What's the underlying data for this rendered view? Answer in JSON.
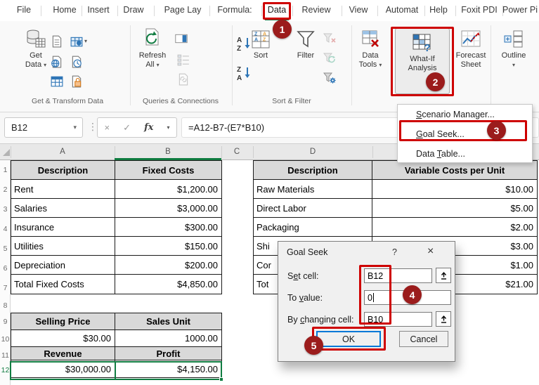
{
  "tabs": [
    "File",
    "Home",
    "Insert",
    "Draw",
    "Page Lay",
    "Formula:",
    "Data",
    "Review",
    "View",
    "Automat",
    "Help",
    "Foxit PDI",
    "Power Pi"
  ],
  "ribbon": {
    "get_data": {
      "line1": "Get",
      "line2": "Data"
    },
    "refresh_all": {
      "line1": "Refresh",
      "line2": "All"
    },
    "sort": "Sort",
    "filter": "Filter",
    "data_tools": {
      "line1": "Data",
      "line2": "Tools"
    },
    "what_if": {
      "line1": "What-If",
      "line2": "Analysis"
    },
    "forecast": {
      "line1": "Forecast",
      "line2": "Sheet"
    },
    "outline": "Outline",
    "group_labels": {
      "g1": "Get & Transform Data",
      "g2": "Queries & Connections",
      "g3": "Sort & Filter"
    }
  },
  "formula_bar": {
    "name_box": "B12",
    "formula": "=A12-B7-(E7*B10)"
  },
  "glyphs": {
    "chevron_down": "▾",
    "dots": "⋮",
    "cancel_x": "×",
    "check": "✓",
    "fx": "fx"
  },
  "menu": {
    "items": [
      {
        "pre": "",
        "key": "S",
        "post": "cenario Manager..."
      },
      {
        "pre": "",
        "key": "G",
        "post": "oal Seek..."
      },
      {
        "pre": "Data ",
        "key": "T",
        "post": "able..."
      }
    ]
  },
  "sheet": {
    "col_headers": [
      "A",
      "B",
      "C",
      "D"
    ],
    "rows": [
      "1",
      "2",
      "3",
      "4",
      "5",
      "6",
      "7",
      "8",
      "9",
      "10",
      "11",
      "12"
    ],
    "left_top": [
      [
        "Description",
        "Fixed Costs"
      ],
      [
        "Rent",
        "$1,200.00"
      ],
      [
        "Salaries",
        "$3,000.00"
      ],
      [
        "Insurance",
        "$300.00"
      ],
      [
        "Utilities",
        "$150.00"
      ],
      [
        "Depreciation",
        "$200.00"
      ],
      [
        "Total Fixed Costs",
        "$4,850.00"
      ]
    ],
    "left_bottom": [
      [
        "Selling Price",
        "Sales Unit"
      ],
      [
        "$30.00",
        "1000.00"
      ],
      [
        "Revenue",
        "Profit"
      ],
      [
        "$30,000.00",
        "$4,150.00"
      ]
    ],
    "right": [
      [
        "Description",
        "Variable Costs per Unit"
      ],
      [
        "Raw Materials",
        "$10.00"
      ],
      [
        "Direct Labor",
        "$5.00"
      ],
      [
        "Packaging",
        "$2.00"
      ],
      [
        "Shi",
        "$3.00"
      ],
      [
        "Cor",
        "$1.00"
      ],
      [
        "Tot",
        "$21.00"
      ]
    ]
  },
  "dialog": {
    "title": "Goal Seek",
    "help": "?",
    "close": "×",
    "fields": [
      {
        "pre": "S",
        "key": "e",
        "post": "t cell:",
        "value": "B12"
      },
      {
        "pre": "To ",
        "key": "v",
        "post": "alue:",
        "value": "0"
      },
      {
        "pre": "By ",
        "key": "c",
        "post": "hanging cell:",
        "value": "B10"
      }
    ],
    "ok": "OK",
    "cancel": "Cancel"
  },
  "steps": [
    "1",
    "2",
    "3",
    "4",
    "5"
  ],
  "colors": {
    "excel_green": "#217346",
    "selection_green": "#107C41",
    "annotation_red": "#CE0000",
    "badge_red": "#9B1C1C",
    "ok_border_blue": "#0078D7"
  }
}
